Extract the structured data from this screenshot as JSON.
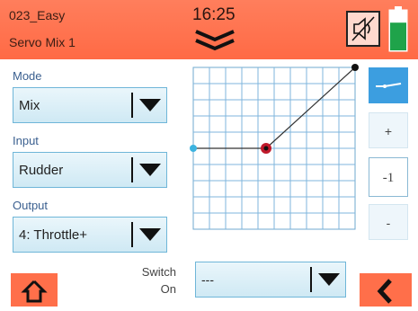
{
  "header": {
    "model_name": "023_Easy",
    "screen_title": "Servo Mix 1",
    "time": "16:25",
    "menu_icon": "double-chevron-down-icon",
    "mute_icon": "speaker-muted-icon",
    "battery_icon": "battery-icon",
    "battery_level": 0.7
  },
  "colors": {
    "header": "#ff6a45",
    "accent": "#3c9ee0",
    "battery": "#1fa34a"
  },
  "fields": {
    "mode": {
      "label": "Mode",
      "value": "Mix"
    },
    "input": {
      "label": "Input",
      "value": "Rudder"
    },
    "output": {
      "label": "Output",
      "value": "4: Throttle+"
    }
  },
  "curve": {
    "points": [
      [
        -100,
        0
      ],
      [
        -10,
        0
      ],
      [
        100,
        100
      ]
    ],
    "active_point": [
      -10,
      0
    ]
  },
  "side": {
    "curve_icon": "curve-mode-icon",
    "plus": "+",
    "value": "-1",
    "minus": "-"
  },
  "switch": {
    "label_line1": "Switch",
    "label_line2": "On",
    "value": "---"
  },
  "footer": {
    "home_icon": "home-icon",
    "back_icon": "back-arrow-icon"
  }
}
